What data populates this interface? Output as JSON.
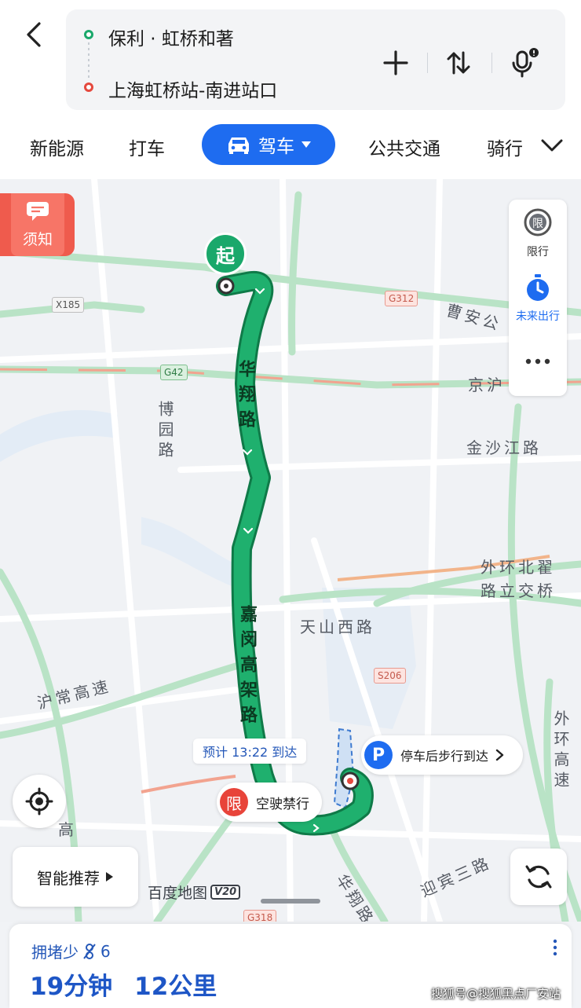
{
  "route": {
    "start": "保利 · 虹桥和著",
    "end": "上海虹桥站-南进站口"
  },
  "tabs": [
    {
      "label": "新能源"
    },
    {
      "label": "打车"
    },
    {
      "label": "驾车",
      "active": true
    },
    {
      "label": "公共交通"
    },
    {
      "label": "骑行"
    }
  ],
  "map": {
    "notice_label": "须知",
    "restriction_label": "限行",
    "restriction_icon_text": "限",
    "future_label": "未来出行",
    "start_marker": "起",
    "road_labels": {
      "huaxiang": "华翔路",
      "jiamin": "嘉闵高架路",
      "caoan": "曹安公",
      "jinghu": "京沪",
      "boyuan": "博园路",
      "jinshajiang": "金沙江路",
      "waihuan1": "外环北翟",
      "waihuan2": "路立交桥",
      "tianshan": "天山西路",
      "huchang": "沪常高速",
      "waihuanhs": "外环高速",
      "yingbin": "迎宾三路",
      "huaxiang2": "华翔路",
      "gao": "高"
    },
    "shields": {
      "x185": "X185",
      "g312": "G312",
      "g42": "G42",
      "s206": "S206",
      "g318": "G318"
    },
    "eta": "预计 13:22 到达",
    "parking_text": "停车后步行到达",
    "parking_icon": "P",
    "restrict_icon": "限",
    "restrict_text": "空驶禁行",
    "smart_label": "智能推荐",
    "brand": "百度地图",
    "brand_version": "V20"
  },
  "summary": {
    "traffic": "拥堵少",
    "lights": "6",
    "duration": "19分钟",
    "distance": "12公里"
  },
  "watermark": "搜狐号@搜狐黑点厂安站",
  "colors": {
    "accent": "#1e6cf0",
    "route": "#1aa86b",
    "alert": "#e8443a"
  }
}
